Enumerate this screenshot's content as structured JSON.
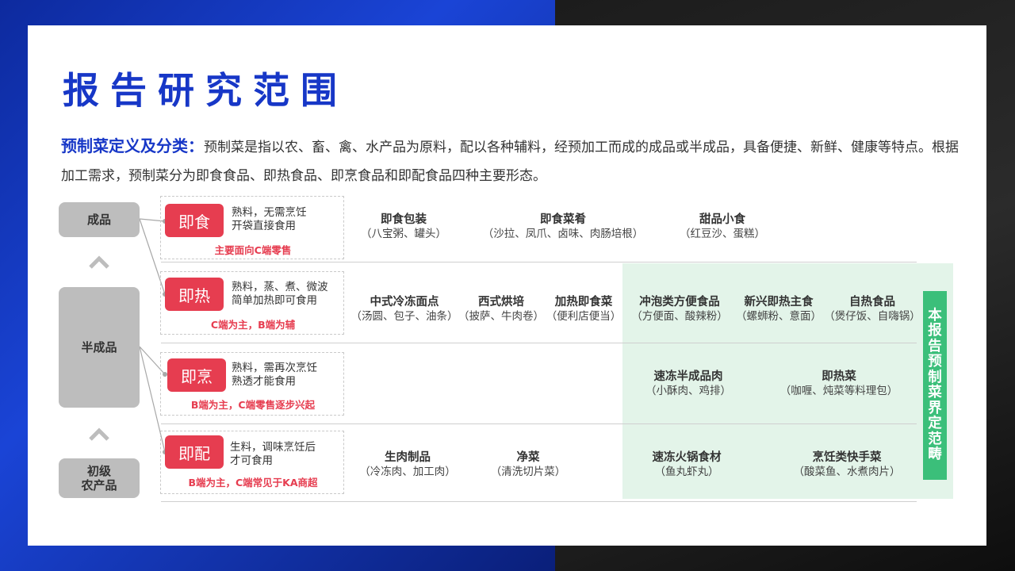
{
  "title": "报告研究范围",
  "intro": {
    "lead": "预制菜定义及分类：",
    "text": "预制菜是指以农、畜、禽、水产品为原料，配以各种辅料，经预加工而成的成品或半成品，具备便捷、新鲜、健康等特点。根据加工需求，预制菜分为即食食品、即热食品、即烹食品和即配食品四种主要形态。"
  },
  "stages": {
    "finished": "成品",
    "semi": "半成品",
    "raw_line1": "初级",
    "raw_line2": "农产品"
  },
  "categories": [
    {
      "tag": "即食",
      "desc1": "熟料，无需烹饪",
      "desc2": "开袋直接食用",
      "note": "主要面向C端零售"
    },
    {
      "tag": "即热",
      "desc1": "熟料，蒸、煮、微波",
      "desc2": "简单加热即可食用",
      "note": "C端为主，B端为辅"
    },
    {
      "tag": "即烹",
      "desc1": "熟料，需再次烹饪",
      "desc2": "熟透才能食用",
      "note": "B端为主，C端零售逐步兴起"
    },
    {
      "tag": "即配",
      "desc1": "生料，调味烹饪后",
      "desc2": "才可食用",
      "note": "B端为主，C端常见于KA商超"
    }
  ],
  "rows": {
    "ready_to_eat": [
      {
        "name": "即食包装",
        "detail": "（八宝粥、罐头）"
      },
      {
        "name": "即食菜肴",
        "detail": "（沙拉、凤爪、卤味、肉肠培根）"
      },
      {
        "name": "甜品小食",
        "detail": "（红豆沙、蛋糕）"
      }
    ],
    "ready_to_heat": [
      {
        "name": "中式冷冻面点",
        "detail": "（汤圆、包子、油条）"
      },
      {
        "name": "西式烘培",
        "detail": "（披萨、牛肉卷）"
      },
      {
        "name": "加热即食菜",
        "detail": "（便利店便当）"
      },
      {
        "name": "冲泡类方便食品",
        "detail": "（方便面、酸辣粉）"
      },
      {
        "name": "新兴即热主食",
        "detail": "（螺蛳粉、意面）"
      },
      {
        "name": "自热食品",
        "detail": "（煲仔饭、自嗨锅）"
      }
    ],
    "ready_to_cook": [
      {
        "name": "速冻半成品肉",
        "detail": "（小酥肉、鸡排）"
      },
      {
        "name": "即热菜",
        "detail": "（咖喱、炖菜等料理包）"
      }
    ],
    "ready_to_prepare": [
      {
        "name": "生肉制品",
        "detail": "（冷冻肉、加工肉）"
      },
      {
        "name": "净菜",
        "detail": "（清洗切片菜）"
      },
      {
        "name": "速冻火锅食材",
        "detail": "（鱼丸虾丸）"
      },
      {
        "name": "烹饪类快手菜",
        "detail": "（酸菜鱼、水煮肉片）"
      }
    ]
  },
  "side_label": [
    "本",
    "报",
    "告",
    "预",
    "制",
    "菜",
    "界",
    "定",
    "范",
    "畴"
  ],
  "colors": {
    "title_blue": "#1737c7",
    "tag_red": "#e63d50",
    "stage_gray": "#bdbdbd",
    "scope_green": "#3bbf7a",
    "scope_bg": "#e3f4e9"
  }
}
